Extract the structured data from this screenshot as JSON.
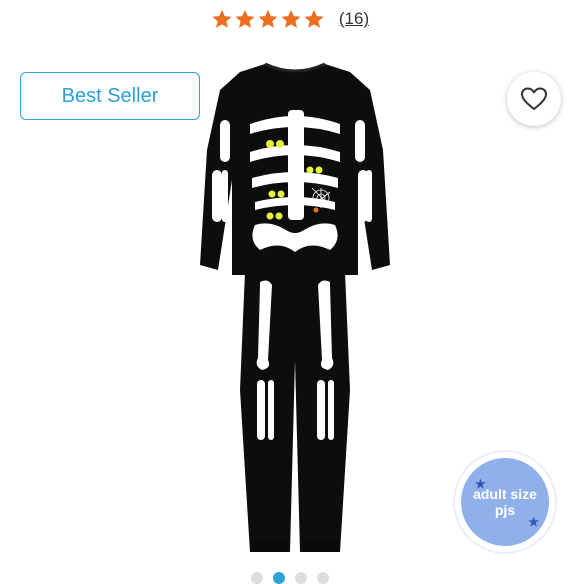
{
  "rating": {
    "stars": 5,
    "count": "(16)"
  },
  "badge": {
    "label": "Best Seller"
  },
  "colors": {
    "star": "#ec6f1f",
    "accent": "#2aa1d8",
    "garment": "#0d0d0d",
    "bone": "#ffffff",
    "glow": "#e7f53a"
  },
  "favorite": {
    "icon": "heart-outline-icon"
  },
  "sticker": {
    "line1": "adult size",
    "line2": "pjs"
  },
  "carousel": {
    "total": 4,
    "active": 2
  }
}
